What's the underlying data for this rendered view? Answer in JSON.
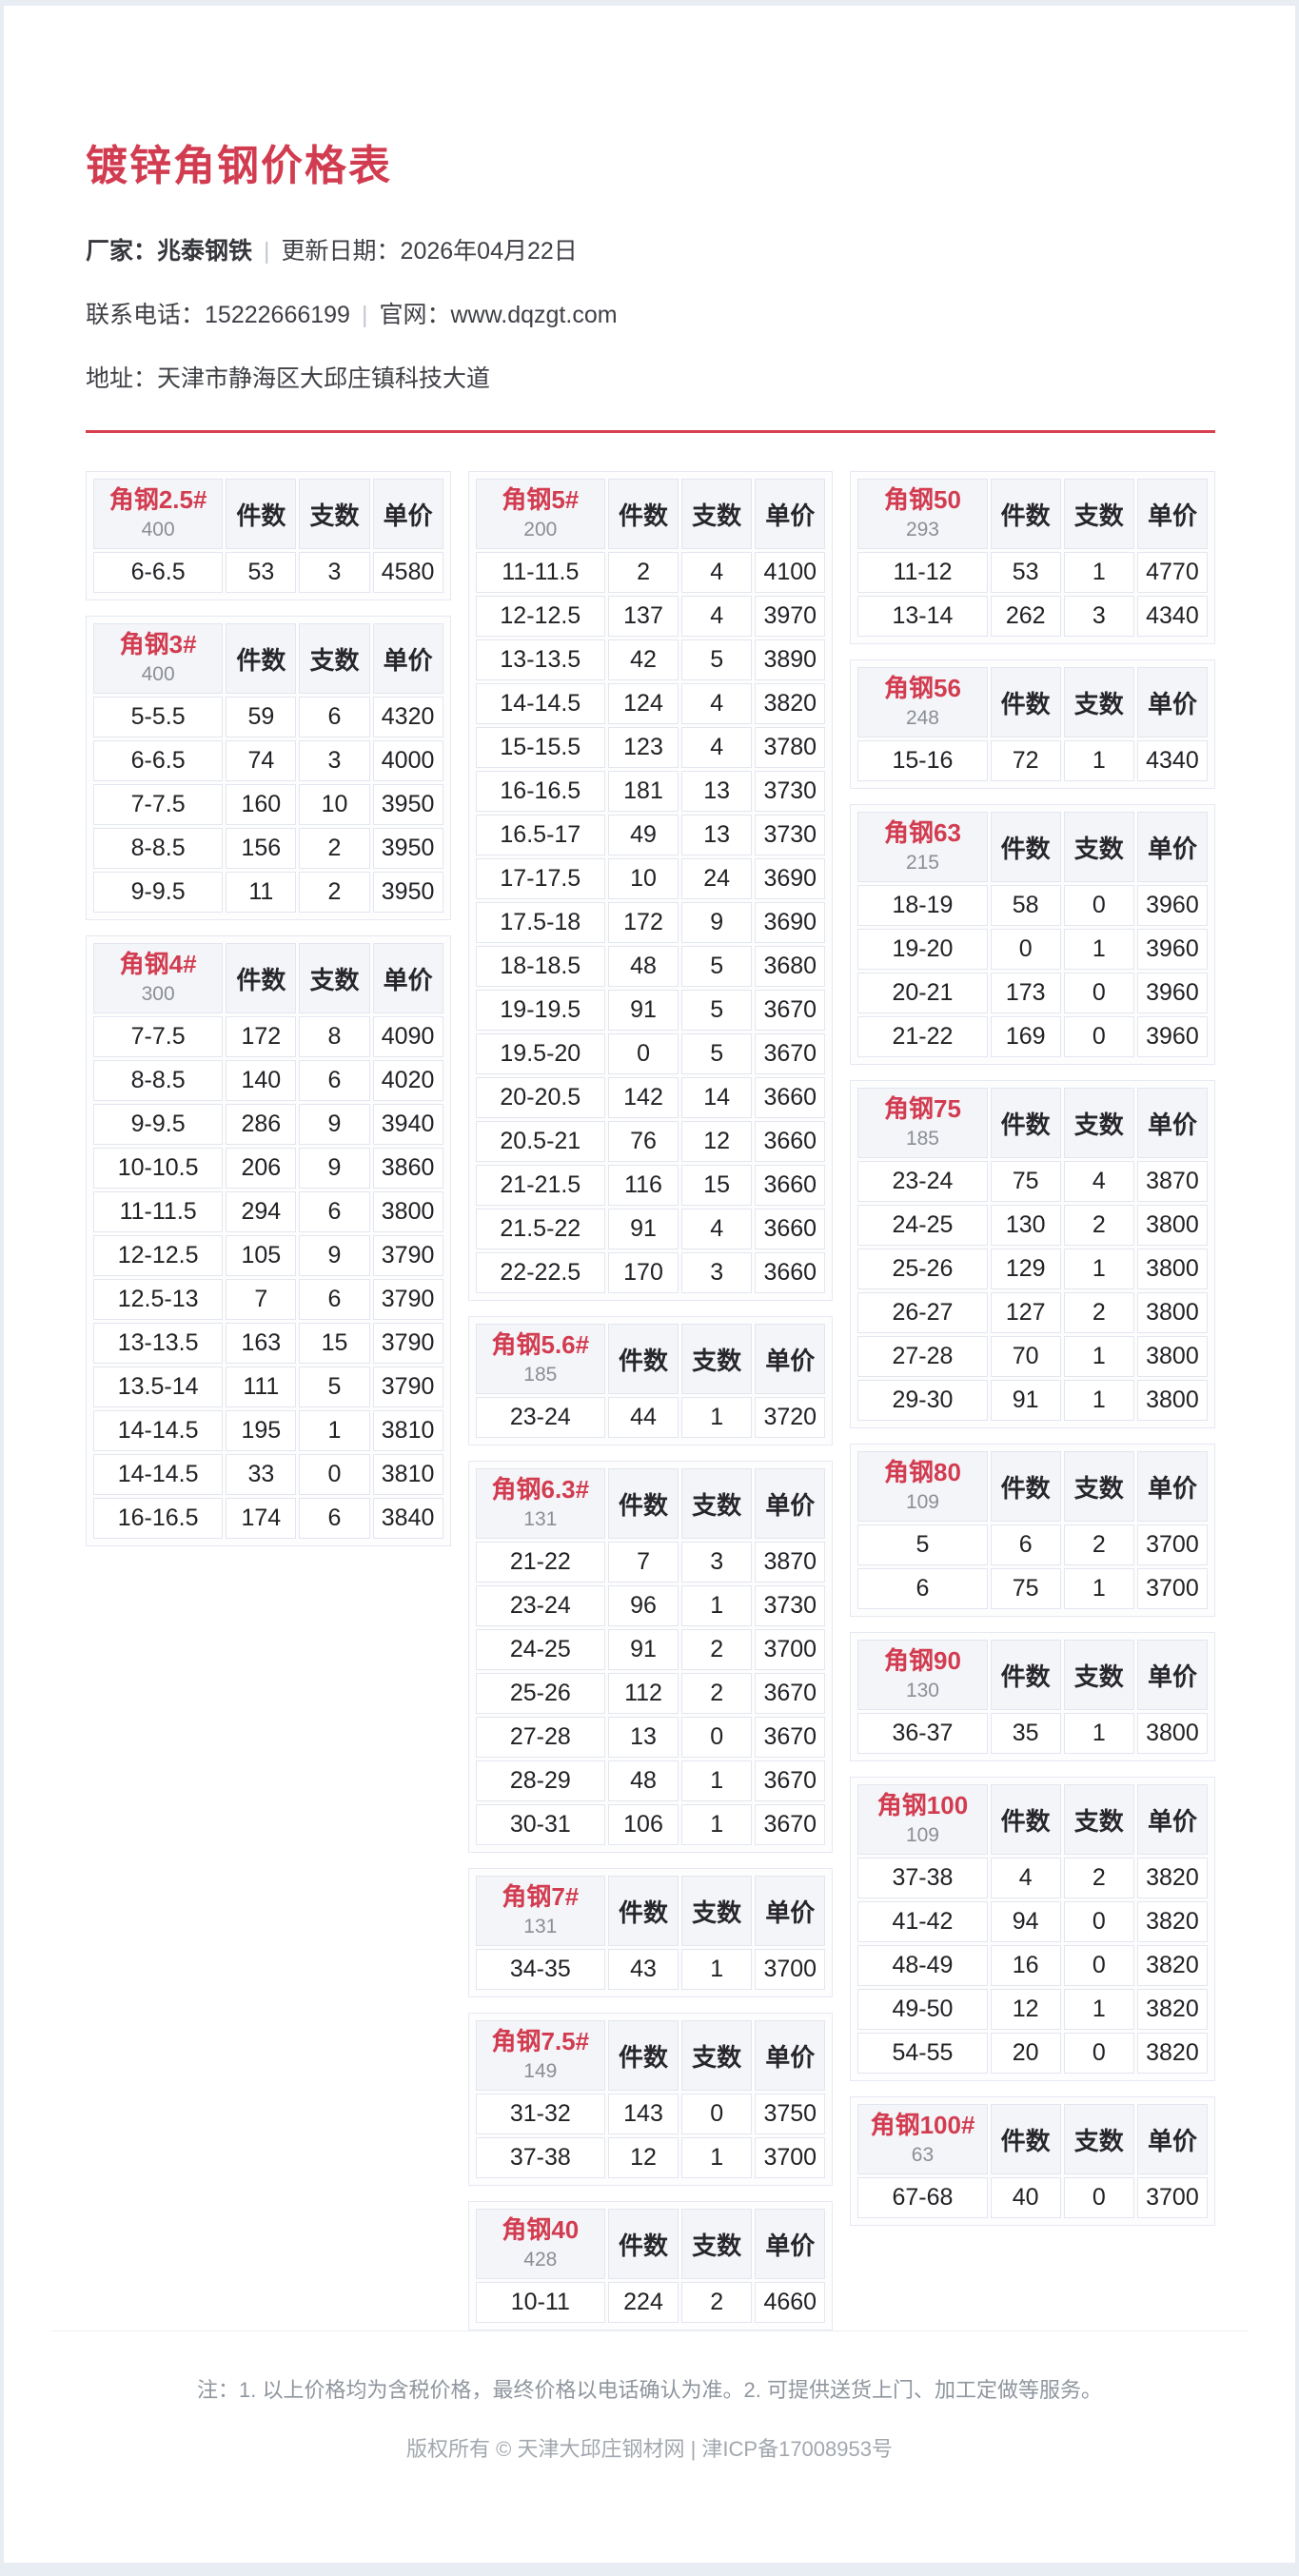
{
  "header": {
    "title": "镀锌角钢价格表",
    "factory_label": "厂家：",
    "factory": "兆泰钢铁",
    "sep": "|",
    "update_label": "更新日期：",
    "update_date": "2026年04月22日",
    "phone_label": "联系电话：",
    "phone": "15222666199",
    "website_label": "官网：",
    "website": "www.dqzgt.com",
    "address_label": "地址：",
    "address": "天津市静海区大邱庄镇科技大道"
  },
  "col_labels": {
    "qty": "件数",
    "count": "支数",
    "price": "单价"
  },
  "colors": {
    "accent_red": "#d23c50",
    "spec_brown": "#a87e45",
    "price_blue": "#1f72c8"
  },
  "columns": [
    [
      {
        "name": "角钢2.5#",
        "stock": "400",
        "rows": [
          [
            "6-6.5",
            "53",
            "3",
            "4580"
          ]
        ]
      },
      {
        "name": "角钢3#",
        "stock": "400",
        "rows": [
          [
            "5-5.5",
            "59",
            "6",
            "4320"
          ],
          [
            "6-6.5",
            "74",
            "3",
            "4000"
          ],
          [
            "7-7.5",
            "160",
            "10",
            "3950"
          ],
          [
            "8-8.5",
            "156",
            "2",
            "3950"
          ],
          [
            "9-9.5",
            "11",
            "2",
            "3950"
          ]
        ]
      },
      {
        "name": "角钢4#",
        "stock": "300",
        "rows": [
          [
            "7-7.5",
            "172",
            "8",
            "4090"
          ],
          [
            "8-8.5",
            "140",
            "6",
            "4020"
          ],
          [
            "9-9.5",
            "286",
            "9",
            "3940"
          ],
          [
            "10-10.5",
            "206",
            "9",
            "3860"
          ],
          [
            "11-11.5",
            "294",
            "6",
            "3800"
          ],
          [
            "12-12.5",
            "105",
            "9",
            "3790"
          ],
          [
            "12.5-13",
            "7",
            "6",
            "3790"
          ],
          [
            "13-13.5",
            "163",
            "15",
            "3790"
          ],
          [
            "13.5-14",
            "111",
            "5",
            "3790"
          ],
          [
            "14-14.5",
            "195",
            "1",
            "3810"
          ],
          [
            "14-14.5",
            "33",
            "0",
            "3810"
          ],
          [
            "16-16.5",
            "174",
            "6",
            "3840"
          ]
        ]
      }
    ],
    [
      {
        "name": "角钢5#",
        "stock": "200",
        "rows": [
          [
            "11-11.5",
            "2",
            "4",
            "4100"
          ],
          [
            "12-12.5",
            "137",
            "4",
            "3970"
          ],
          [
            "13-13.5",
            "42",
            "5",
            "3890"
          ],
          [
            "14-14.5",
            "124",
            "4",
            "3820"
          ],
          [
            "15-15.5",
            "123",
            "4",
            "3780"
          ],
          [
            "16-16.5",
            "181",
            "13",
            "3730"
          ],
          [
            "16.5-17",
            "49",
            "13",
            "3730"
          ],
          [
            "17-17.5",
            "10",
            "24",
            "3690"
          ],
          [
            "17.5-18",
            "172",
            "9",
            "3690"
          ],
          [
            "18-18.5",
            "48",
            "5",
            "3680"
          ],
          [
            "19-19.5",
            "91",
            "5",
            "3670"
          ],
          [
            "19.5-20",
            "0",
            "5",
            "3670"
          ],
          [
            "20-20.5",
            "142",
            "14",
            "3660"
          ],
          [
            "20.5-21",
            "76",
            "12",
            "3660"
          ],
          [
            "21-21.5",
            "116",
            "15",
            "3660"
          ],
          [
            "21.5-22",
            "91",
            "4",
            "3660"
          ],
          [
            "22-22.5",
            "170",
            "3",
            "3660"
          ]
        ]
      },
      {
        "name": "角钢5.6#",
        "stock": "185",
        "rows": [
          [
            "23-24",
            "44",
            "1",
            "3720"
          ]
        ]
      },
      {
        "name": "角钢6.3#",
        "stock": "131",
        "rows": [
          [
            "21-22",
            "7",
            "3",
            "3870"
          ],
          [
            "23-24",
            "96",
            "1",
            "3730"
          ],
          [
            "24-25",
            "91",
            "2",
            "3700"
          ],
          [
            "25-26",
            "112",
            "2",
            "3670"
          ],
          [
            "27-28",
            "13",
            "0",
            "3670"
          ],
          [
            "28-29",
            "48",
            "1",
            "3670"
          ],
          [
            "30-31",
            "106",
            "1",
            "3670"
          ]
        ]
      },
      {
        "name": "角钢7#",
        "stock": "131",
        "rows": [
          [
            "34-35",
            "43",
            "1",
            "3700"
          ]
        ]
      },
      {
        "name": "角钢7.5#",
        "stock": "149",
        "rows": [
          [
            "31-32",
            "143",
            "0",
            "3750"
          ],
          [
            "37-38",
            "12",
            "1",
            "3700"
          ]
        ]
      },
      {
        "name": "角钢40",
        "stock": "428",
        "rows": [
          [
            "10-11",
            "224",
            "2",
            "4660"
          ]
        ]
      }
    ],
    [
      {
        "name": "角钢50",
        "stock": "293",
        "rows": [
          [
            "11-12",
            "53",
            "1",
            "4770"
          ],
          [
            "13-14",
            "262",
            "3",
            "4340"
          ]
        ]
      },
      {
        "name": "角钢56",
        "stock": "248",
        "rows": [
          [
            "15-16",
            "72",
            "1",
            "4340"
          ]
        ]
      },
      {
        "name": "角钢63",
        "stock": "215",
        "rows": [
          [
            "18-19",
            "58",
            "0",
            "3960"
          ],
          [
            "19-20",
            "0",
            "1",
            "3960"
          ],
          [
            "20-21",
            "173",
            "0",
            "3960"
          ],
          [
            "21-22",
            "169",
            "0",
            "3960"
          ]
        ]
      },
      {
        "name": "角钢75",
        "stock": "185",
        "rows": [
          [
            "23-24",
            "75",
            "4",
            "3870"
          ],
          [
            "24-25",
            "130",
            "2",
            "3800"
          ],
          [
            "25-26",
            "129",
            "1",
            "3800"
          ],
          [
            "26-27",
            "127",
            "2",
            "3800"
          ],
          [
            "27-28",
            "70",
            "1",
            "3800"
          ],
          [
            "29-30",
            "91",
            "1",
            "3800"
          ]
        ]
      },
      {
        "name": "角钢80",
        "stock": "109",
        "rows": [
          [
            "5",
            "6",
            "2",
            "3700"
          ],
          [
            "6",
            "75",
            "1",
            "3700"
          ]
        ]
      },
      {
        "name": "角钢90",
        "stock": "130",
        "rows": [
          [
            "36-37",
            "35",
            "1",
            "3800"
          ]
        ]
      },
      {
        "name": "角钢100",
        "stock": "109",
        "rows": [
          [
            "37-38",
            "4",
            "2",
            "3820"
          ],
          [
            "41-42",
            "94",
            "0",
            "3820"
          ],
          [
            "48-49",
            "16",
            "0",
            "3820"
          ],
          [
            "49-50",
            "12",
            "1",
            "3820"
          ],
          [
            "54-55",
            "20",
            "0",
            "3820"
          ]
        ]
      },
      {
        "name": "角钢100#",
        "stock": "63",
        "rows": [
          [
            "67-68",
            "40",
            "0",
            "3700"
          ]
        ]
      }
    ]
  ],
  "footer": {
    "note": "注：1. 以上价格均为含税价格，最终价格以电话确认为准。2. 可提供送货上门、加工定做等服务。",
    "copyright": "版权所有 © 天津大邱庄钢材网 | 津ICP备17008953号"
  }
}
